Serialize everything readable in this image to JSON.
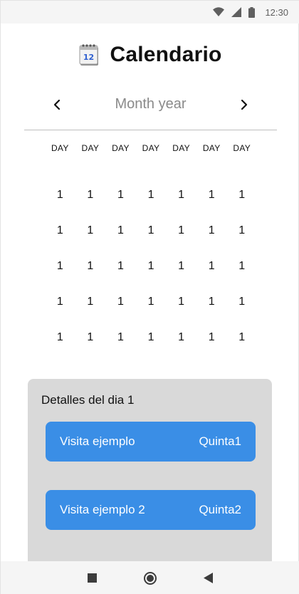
{
  "status_bar": {
    "time": "12:30"
  },
  "header": {
    "title": "Calendario",
    "icon": "calendar-icon"
  },
  "month_nav": {
    "label": "Month year",
    "prev": "chevron-left-icon",
    "next": "chevron-right-icon"
  },
  "calendar": {
    "day_headers": [
      "DAY",
      "DAY",
      "DAY",
      "DAY",
      "DAY",
      "DAY",
      "DAY"
    ],
    "weeks": [
      [
        "1",
        "1",
        "1",
        "1",
        "1",
        "1",
        "1"
      ],
      [
        "1",
        "1",
        "1",
        "1",
        "1",
        "1",
        "1"
      ],
      [
        "1",
        "1",
        "1",
        "1",
        "1",
        "1",
        "1"
      ],
      [
        "1",
        "1",
        "1",
        "1",
        "1",
        "1",
        "1"
      ],
      [
        "1",
        "1",
        "1",
        "1",
        "1",
        "1",
        "1"
      ]
    ]
  },
  "details": {
    "title": "Detalles del dia 1",
    "visits": [
      {
        "name": "Visita ejemplo",
        "place": "Quinta1"
      },
      {
        "name": "Visita ejemplo 2",
        "place": "Quinta2"
      }
    ]
  },
  "colors": {
    "accent": "#3a8ee6",
    "panel": "#d9d9d9"
  }
}
